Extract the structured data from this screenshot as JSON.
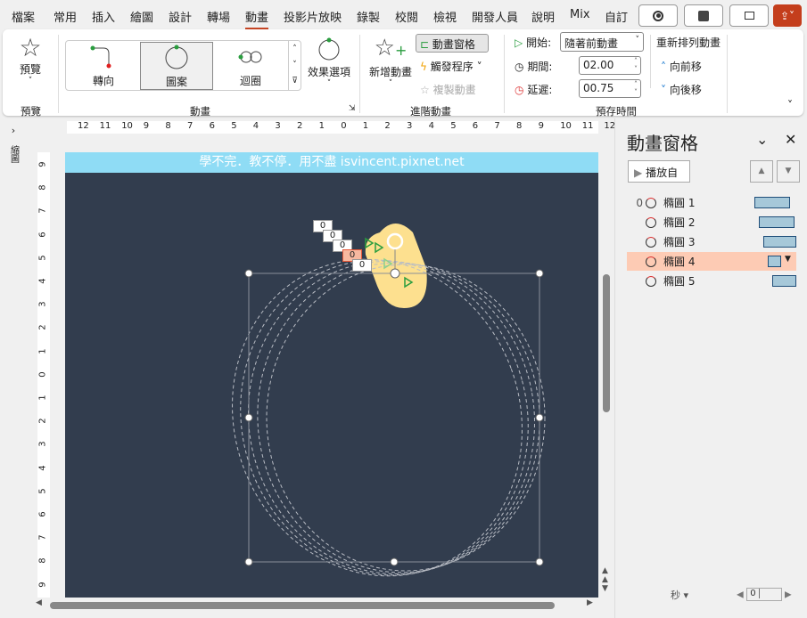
{
  "tabs": [
    "檔案",
    "常用",
    "插入",
    "繪圖",
    "設計",
    "轉場",
    "動畫",
    "投影片放映",
    "錄製",
    "校閱",
    "檢視",
    "開發人員",
    "說明",
    "Mix",
    "自訂"
  ],
  "ribbon": {
    "preview": "預覽",
    "preview_group": "預覽",
    "effects": [
      "轉向",
      "圖案",
      "迴圈"
    ],
    "effect_options": "效果選項",
    "animation_group": "動畫",
    "add_animation": "新增動畫",
    "animation_pane": "動畫窗格",
    "trigger": "觸發程序",
    "animation_painter": "複製動畫",
    "advanced_group": "進階動畫",
    "start_label": "開始:",
    "start_value": "隨著前動畫",
    "duration_label": "期間:",
    "duration_value": "02.00",
    "delay_label": "延遲:",
    "delay_value": "00.75",
    "timing_group": "預存時間",
    "reorder": "重新排列動畫",
    "move_earlier": "向前移",
    "move_later": "向後移"
  },
  "left_panel": "縮圖",
  "ruler_h": [
    "12",
    "11",
    "10",
    "9",
    "8",
    "7",
    "6",
    "5",
    "4",
    "3",
    "2",
    "1",
    "0",
    "1",
    "2",
    "3",
    "4",
    "5",
    "6",
    "7",
    "8",
    "9",
    "10",
    "11",
    "12"
  ],
  "ruler_v": [
    "9",
    "8",
    "7",
    "6",
    "5",
    "4",
    "3",
    "2",
    "1",
    "0",
    "1",
    "2",
    "3",
    "4",
    "5",
    "6",
    "7",
    "8",
    "9"
  ],
  "slide": {
    "banner": "學不完．教不停．用不盡 isvincent.pixnet.net",
    "tags": [
      "0",
      "0",
      "0",
      "0",
      "0"
    ]
  },
  "pane": {
    "title": "動畫窗格",
    "play_from": "播放自",
    "items": [
      {
        "order": "0",
        "name": "橢圓 1"
      },
      {
        "order": "",
        "name": "橢圓 2"
      },
      {
        "order": "",
        "name": "橢圓 3"
      },
      {
        "order": "",
        "name": "橢圓 4"
      },
      {
        "order": "",
        "name": "橢圓 5"
      }
    ],
    "unit": "秒",
    "zoom": "0"
  },
  "colors": {
    "accent": "#c43e1c",
    "slide_bg": "#323d4e",
    "banner": "#8fdcf5",
    "selected_row": "#fdcbb4"
  }
}
